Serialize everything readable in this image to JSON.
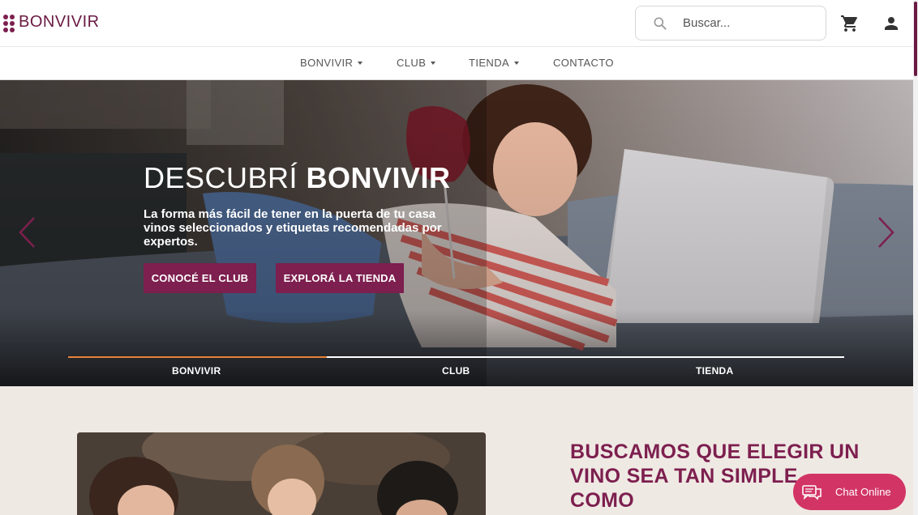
{
  "brand": {
    "name": "BONVIVIR",
    "color": "#7d1f4f"
  },
  "search": {
    "placeholder": "Buscar..."
  },
  "icons": {
    "search": "search-icon",
    "cart": "cart-icon",
    "user": "user-icon",
    "chat": "chat-bubbles-icon"
  },
  "nav": {
    "items": [
      {
        "label": "BONVIVIR",
        "dropdown": true
      },
      {
        "label": "CLUB",
        "dropdown": true
      },
      {
        "label": "TIENDA",
        "dropdown": true
      },
      {
        "label": "CONTACTO",
        "dropdown": false
      }
    ]
  },
  "hero": {
    "title_light": "DESCUBRÍ ",
    "title_bold": "BONVIVIR",
    "subtitle": "La forma más fácil de tener en la puerta de tu casa vinos seleccionados y etiquetas recomendadas por expertos.",
    "buttons": [
      "CONOCÉ EL CLUB",
      "EXPLORÁ LA TIENDA"
    ],
    "slide_tabs": [
      "BONVIVIR",
      "CLUB",
      "TIENDA"
    ],
    "active_slide": 0,
    "progress_fraction": 0.333,
    "progress_color": "#e8833a"
  },
  "section": {
    "headline": "BUSCAMOS QUE ELEGIR UN VINO SEA TAN SIMPLE COMO"
  },
  "chat": {
    "label": "Chat Online",
    "color": "#d23565"
  }
}
